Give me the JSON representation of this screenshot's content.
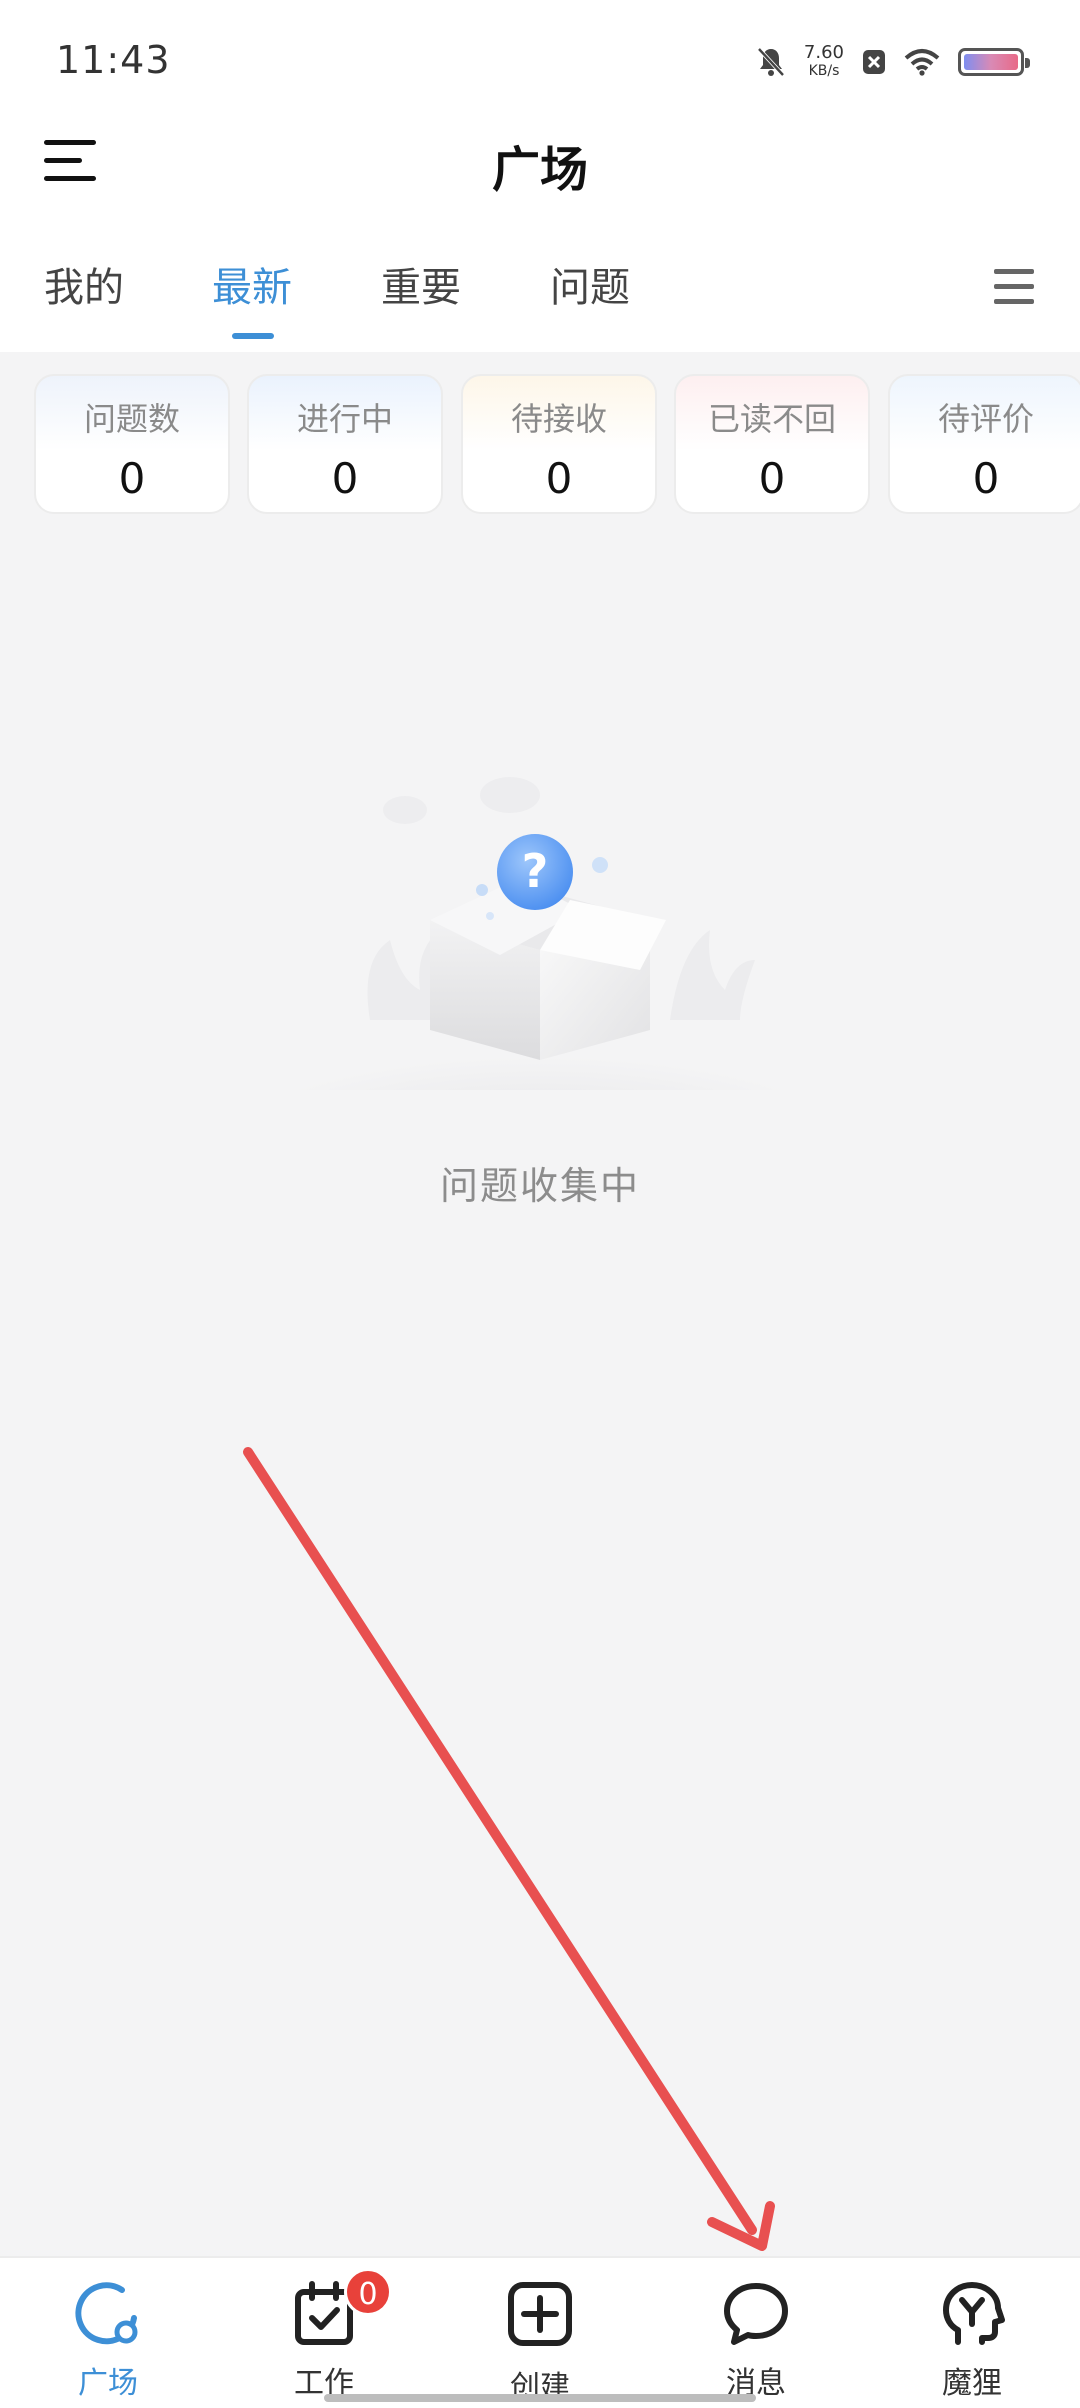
{
  "status_bar": {
    "time": "11:43",
    "net_speed": "7.60",
    "net_unit": "KB/s"
  },
  "header": {
    "title": "广场",
    "menu_icon": "hamburger-menu-icon"
  },
  "tabs": [
    {
      "label": "我的",
      "active": false
    },
    {
      "label": "最新",
      "active": true
    },
    {
      "label": "重要",
      "active": false
    },
    {
      "label": "问题",
      "active": false
    }
  ],
  "stats": [
    {
      "label": "问题数",
      "value": "0"
    },
    {
      "label": "进行中",
      "value": "0"
    },
    {
      "label": "待接收",
      "value": "0"
    },
    {
      "label": "已读不回",
      "value": "0"
    },
    {
      "label": "待评价",
      "value": "0"
    }
  ],
  "empty_state": {
    "text": "问题收集中",
    "glyph": "?"
  },
  "bottom_nav": [
    {
      "label": "广场",
      "icon": "plaza-icon",
      "active": true
    },
    {
      "label": "工作",
      "icon": "calendar-check-icon",
      "badge": "0"
    },
    {
      "label": "创建",
      "icon": "plus-square-icon"
    },
    {
      "label": "消息",
      "icon": "chat-bubble-icon"
    },
    {
      "label": "魔狸",
      "icon": "head-brain-icon"
    }
  ],
  "colors": {
    "accent": "#3d8fd6",
    "badge": "#e8413a",
    "annotation_arrow": "#e85050"
  }
}
